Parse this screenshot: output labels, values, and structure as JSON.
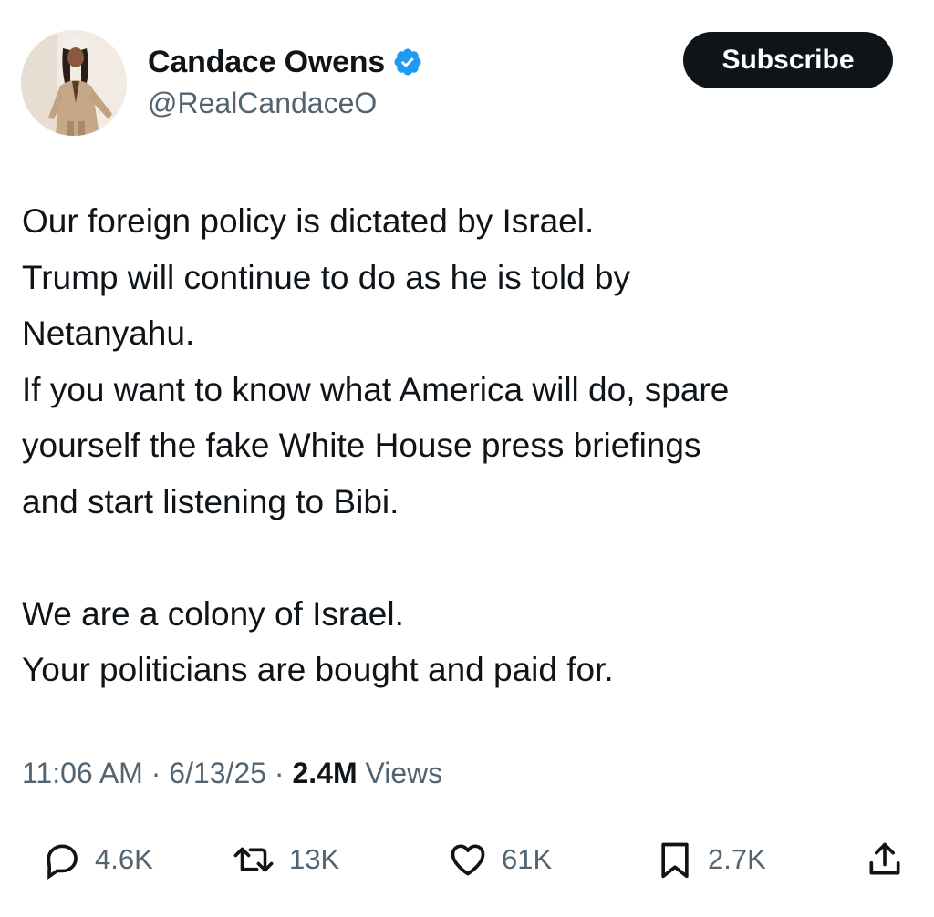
{
  "author": {
    "display_name": "Candace Owens",
    "handle": "@RealCandaceO",
    "verified": true
  },
  "subscribe_label": "Subscribe",
  "tweet": {
    "lines": [
      "Our foreign policy is dictated by Israel.",
      "Trump will continue to do as he is told by",
      "Netanyahu.",
      "If you want to know what America will do, spare",
      "yourself the fake White House press briefings",
      "and start listening to Bibi.",
      "",
      "We are a colony of Israel.",
      "Your politicians are bought and paid for."
    ]
  },
  "meta": {
    "time": "11:06 AM",
    "separator": "·",
    "date": "6/13/25",
    "views_count": "2.4M",
    "views_label": "Views"
  },
  "actions": {
    "replies": "4.6K",
    "reposts": "13K",
    "likes": "61K",
    "bookmarks": "2.7K"
  },
  "icons": {
    "reply": "reply-icon",
    "repost": "repost-icon",
    "like": "like-icon",
    "bookmark": "bookmark-icon",
    "share": "share-icon",
    "verified": "verified-badge-icon"
  },
  "colors": {
    "verified_blue": "#1d9bf0",
    "text_primary": "#0f1419",
    "text_secondary": "#536471",
    "button_bg": "#0f1419"
  }
}
